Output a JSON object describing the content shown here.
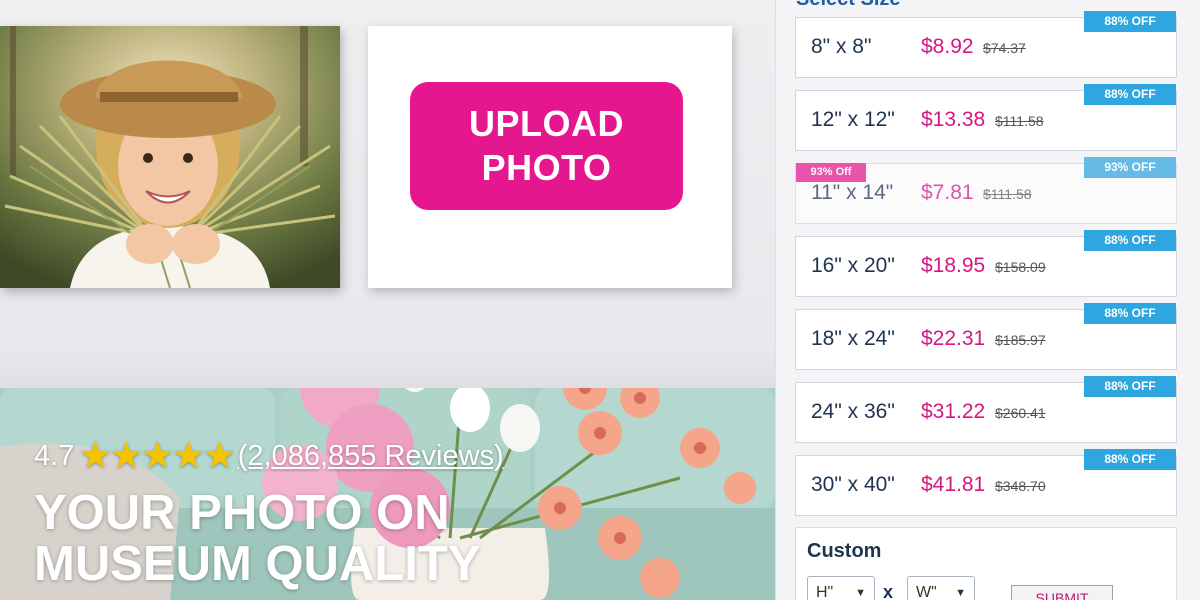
{
  "upload": {
    "label_line1": "UPLOAD",
    "label_line2": "PHOTO"
  },
  "rating": {
    "value": "4.7",
    "stars": 5,
    "reviews_text": "(2,086,855 Reviews)"
  },
  "hero": {
    "title_line1": "YOUR PHOTO ON",
    "title_line2": "MUSEUM QUALITY"
  },
  "panel": {
    "heading": "Select Size"
  },
  "sizes": [
    {
      "size": "8\" x 8\"",
      "price": "$8.92",
      "old_price": "$74.37",
      "discount": "88% OFF"
    },
    {
      "size": "12\" x 12\"",
      "price": "$13.38",
      "old_price": "$111.58",
      "discount": "88% OFF"
    },
    {
      "size": "11\" x 14\"",
      "price": "$7.81",
      "old_price": "$111.58",
      "discount": "93% OFF",
      "promo": "93% Off"
    },
    {
      "size": "16\" x 20\"",
      "price": "$18.95",
      "old_price": "$158.09",
      "discount": "88% OFF"
    },
    {
      "size": "18\" x 24\"",
      "price": "$22.31",
      "old_price": "$185.97",
      "discount": "88% OFF"
    },
    {
      "size": "24\" x 36\"",
      "price": "$31.22",
      "old_price": "$260.41",
      "discount": "88% OFF"
    },
    {
      "size": "30\" x 40\"",
      "price": "$41.81",
      "old_price": "$348.70",
      "discount": "88% OFF"
    }
  ],
  "custom": {
    "title": "Custom",
    "height_value": "H\"",
    "width_value": "W\"",
    "times": "x",
    "submit_label": "SUBMIT"
  },
  "colors": {
    "brand_pink": "#e5178f",
    "price_pink": "#d41880",
    "discount_blue": "#2fa6e0",
    "navy": "#1f3451",
    "star_yellow": "#f4c400"
  },
  "icons": {
    "star": "star-icon",
    "select_caret": "chevron-down-icon"
  }
}
